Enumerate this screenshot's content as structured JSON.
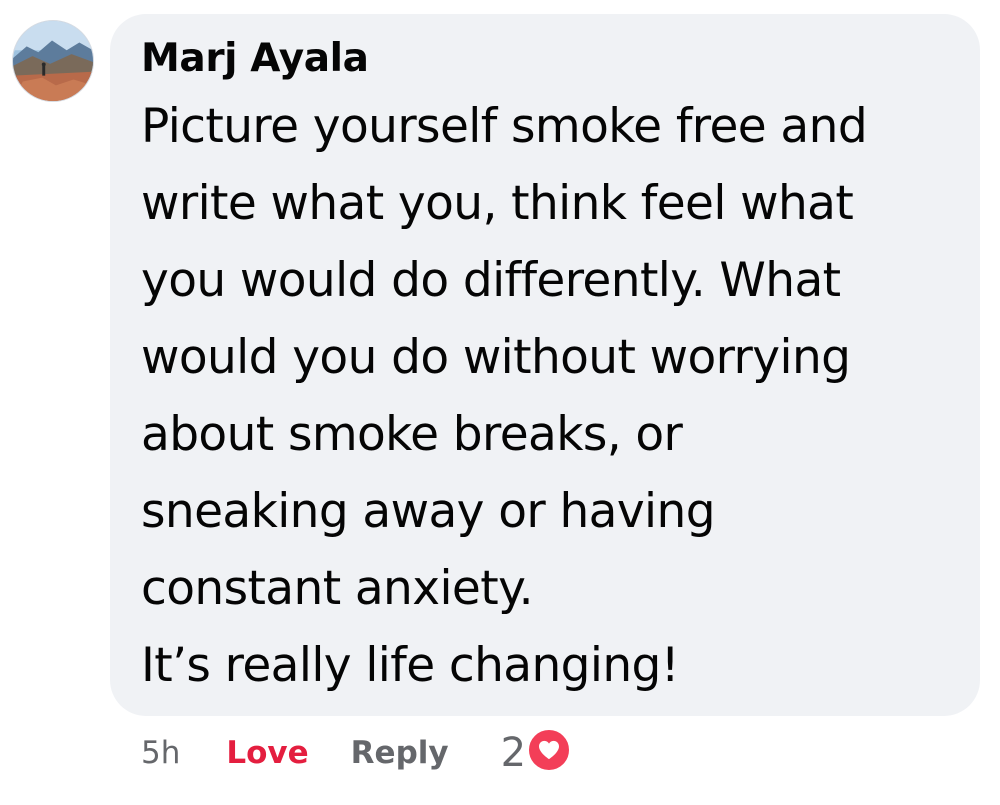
{
  "comment": {
    "author": "Marj Ayala",
    "body_lines": [
      "Picture yourself smoke free and",
      "write what you, think feel what",
      "you would do differently. What",
      "would you do without worrying",
      "about smoke breaks, or",
      "sneaking away or having",
      "constant anxiety.",
      "It’s really life changing!"
    ],
    "timestamp": "5h",
    "love_label": "Love",
    "reply_label": "Reply",
    "reaction_count": "2",
    "reaction_icon": "heart-icon"
  },
  "colors": {
    "bubble_bg": "#f0f2f5",
    "love": "#e41e3f",
    "heart_badge": "#f33e58",
    "muted_text": "#65676b"
  }
}
